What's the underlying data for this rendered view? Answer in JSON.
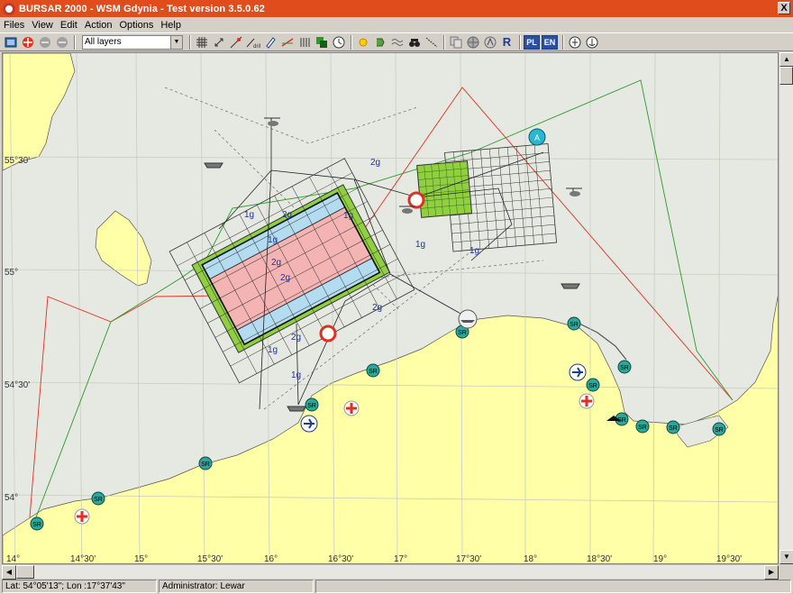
{
  "window": {
    "title": "BURSAR 2000 - WSM Gdynia - Test version 3.5.0.62",
    "close_label": "X"
  },
  "menu": {
    "items": [
      "Files",
      "View",
      "Edit",
      "Action",
      "Options",
      "Help"
    ]
  },
  "toolbar": {
    "layer_select_value": "All layers",
    "lang_pl": "PL",
    "lang_en": "EN",
    "r_label": "R",
    "icons": [
      "map-icon",
      "target-icon",
      "disabled-circle-icon",
      "disabled-circle-icon",
      "grid-icon",
      "zoom-icon",
      "route-icon",
      "drift-icon",
      "pencil-icon",
      "line-icon",
      "parallel-icon",
      "layers-icon",
      "clock-icon",
      "sun-icon",
      "wind-icon",
      "wave-icon",
      "binoculars-icon",
      "track-icon",
      "copy-icon",
      "globe-icon",
      "compass-icon",
      "sign-icon",
      "anchor-icon"
    ]
  },
  "map": {
    "lat_labels": [
      "55°30'",
      "55°",
      "54°30'",
      "54°"
    ],
    "lon_labels": [
      "14°",
      "14°30'",
      "15°",
      "15°30'",
      "16°",
      "16°30'",
      "17°",
      "17°30'",
      "18°",
      "18°30'",
      "19°",
      "19°30'"
    ],
    "markers": {
      "sr_label": "SR",
      "grid_labels": [
        "2g",
        "1g",
        "1g",
        "2g",
        "1g",
        "2g",
        "1g",
        "1g",
        "2g",
        "2g",
        "1g",
        "1g",
        "2g"
      ]
    },
    "colors": {
      "sea": "#e6e9e1",
      "land": "#ffffa8",
      "red_boundary": "#e03020",
      "green_boundary": "#2a9a2a",
      "pink_zone": "#f4b4b4",
      "blue_zone": "#b4dcf0",
      "green_zone": "#90d040",
      "sr_station": "#2ca89a"
    }
  },
  "status": {
    "coords": "Lat: 54°05'13\"; Lon :17°37'43\"",
    "user": "Administrator: Lewar",
    "blank": ""
  }
}
